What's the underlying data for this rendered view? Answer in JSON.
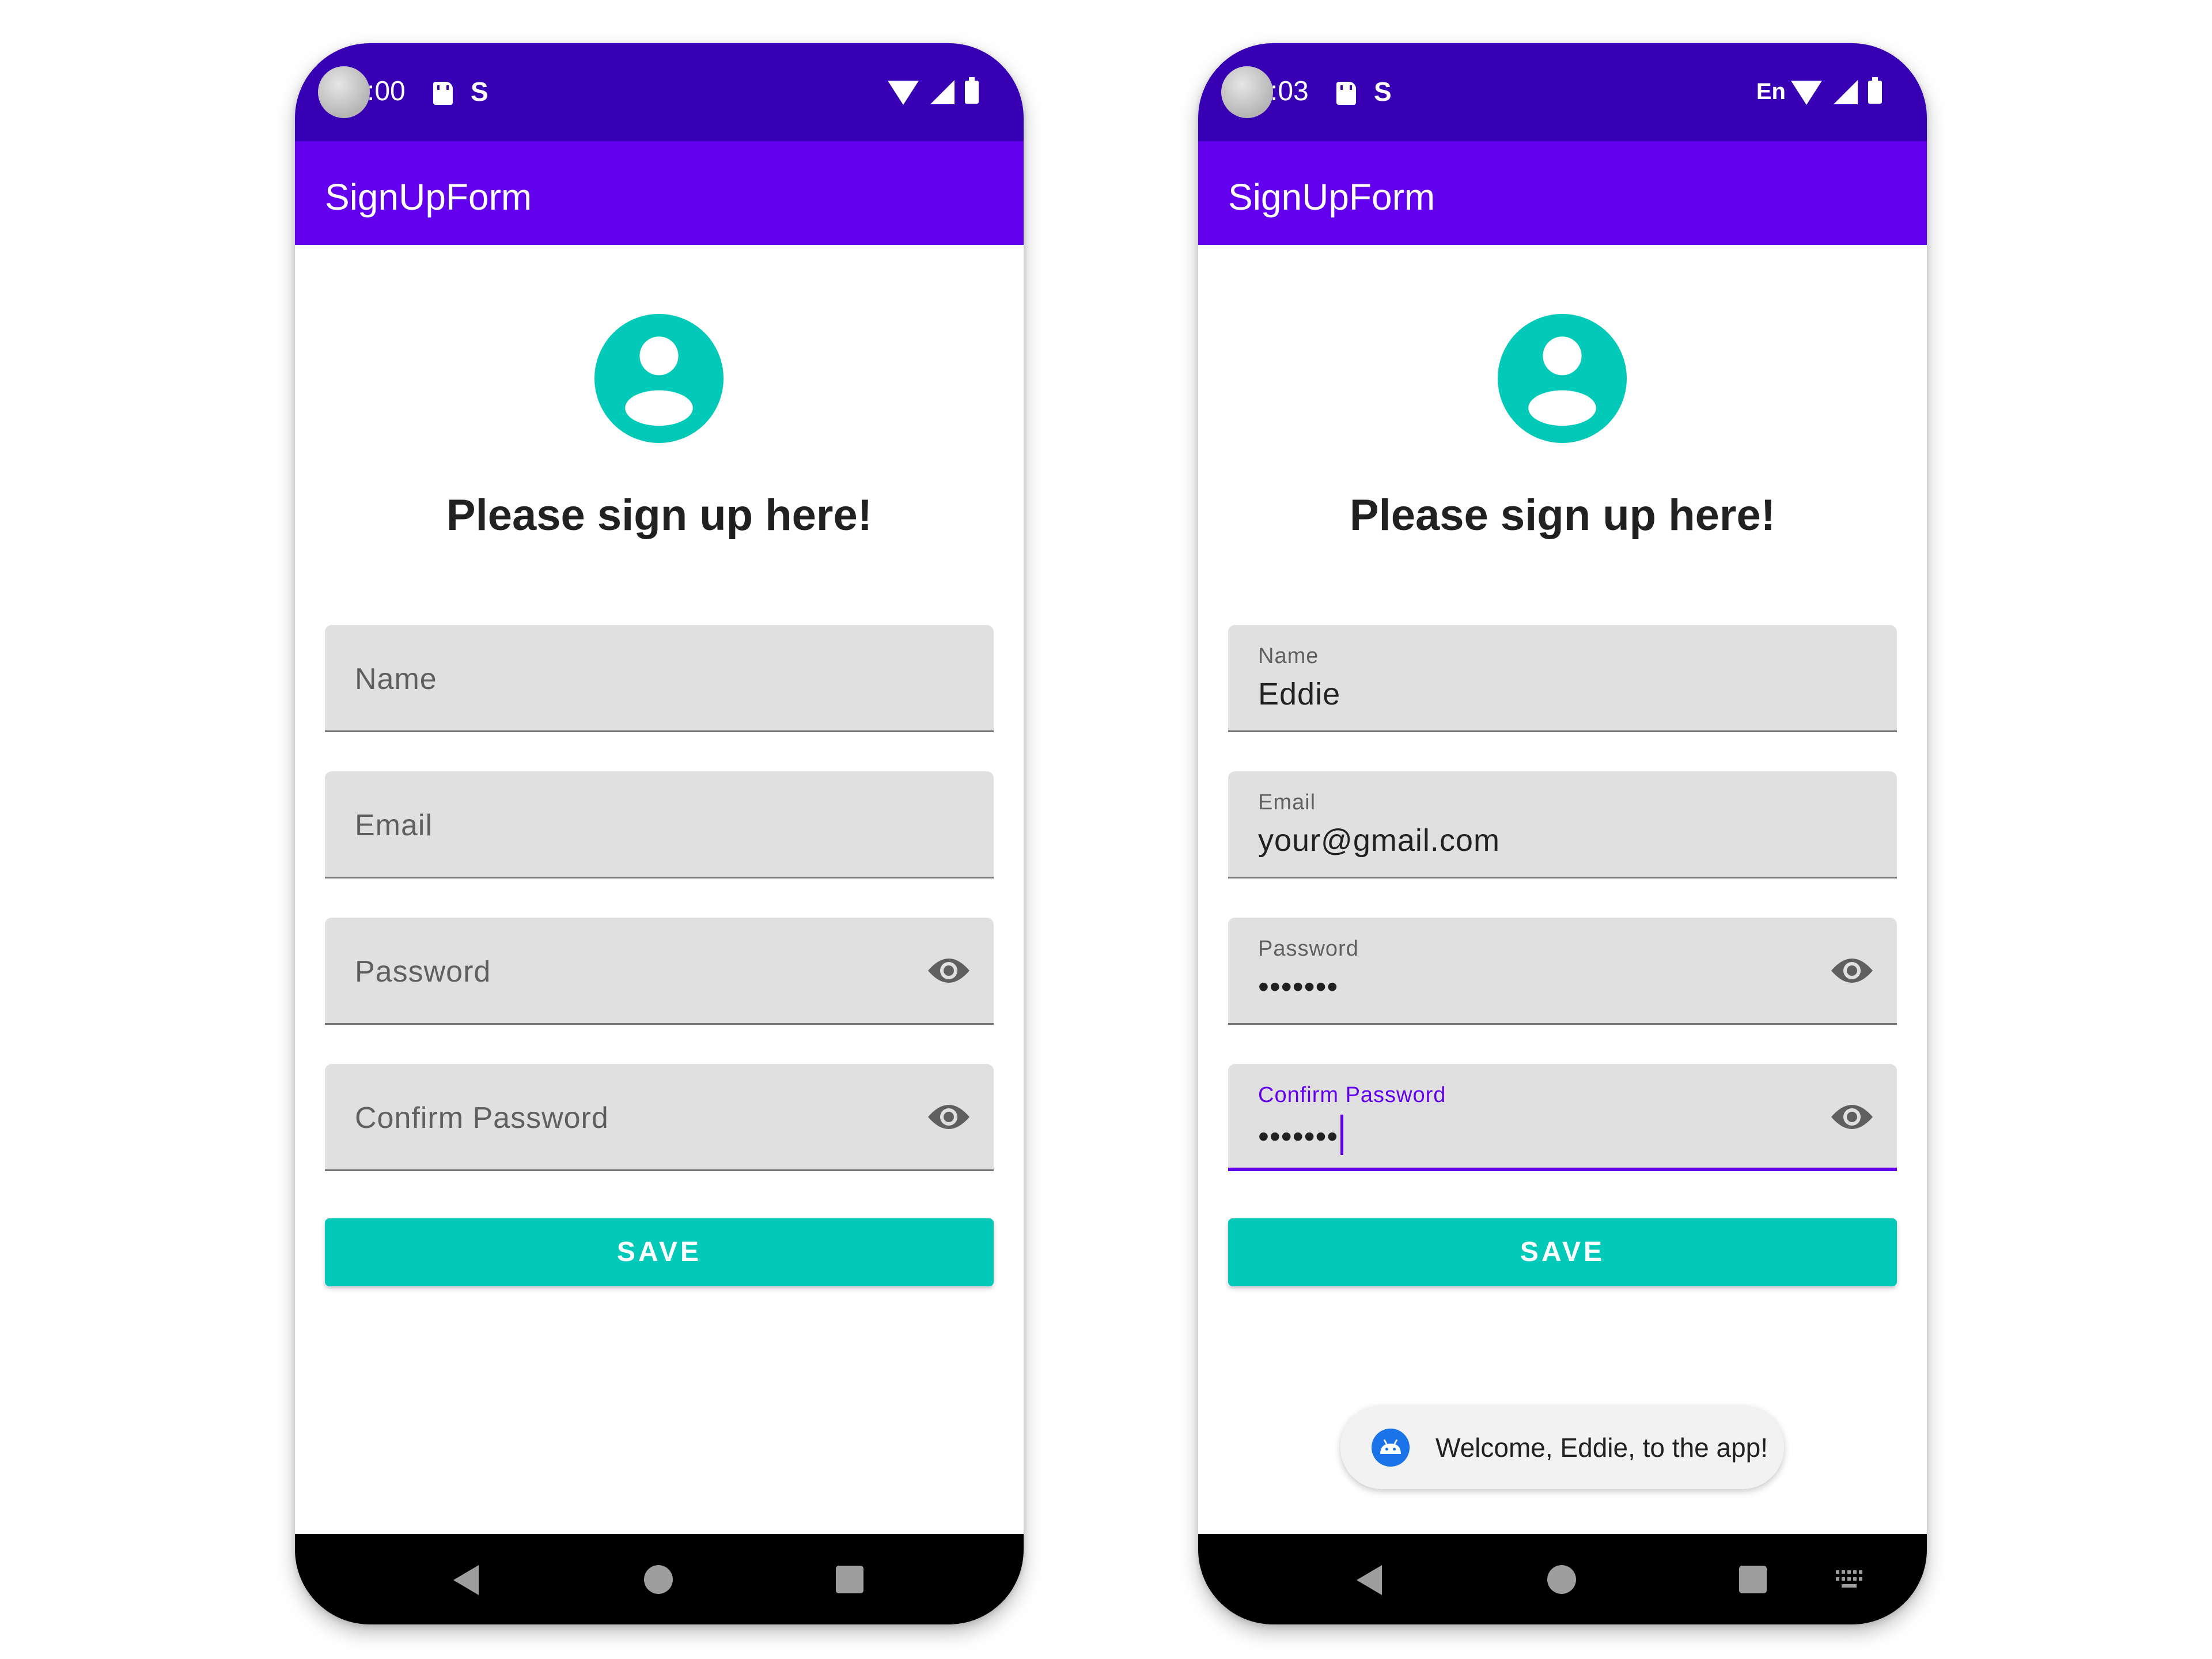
{
  "colors": {
    "status_bar": "#3700B3",
    "app_bar": "#6200EE",
    "accent": "#03C9B8",
    "focus": "#6200EE",
    "field_bg": "#e0e0e0",
    "toast_icon": "#1a73e8"
  },
  "screens": [
    {
      "status_bar": {
        "time": ":00",
        "icons": [
          "sd-card-icon",
          "s-notification-icon",
          "wifi-icon",
          "signal-icon",
          "battery-icon"
        ]
      },
      "app_bar": {
        "title": "SignUpForm"
      },
      "avatar_icon": "account-circle-icon",
      "heading": "Please sign up here!",
      "fields": [
        {
          "placeholder": "Name"
        },
        {
          "placeholder": "Email"
        },
        {
          "placeholder": "Password",
          "icon": "eye-icon"
        },
        {
          "placeholder": "Confirm Password",
          "icon": "eye-icon"
        }
      ],
      "save_button": {
        "label": "SAVE"
      },
      "nav_bar": {
        "buttons": [
          "back-icon",
          "home-icon",
          "recents-icon"
        ]
      }
    },
    {
      "status_bar": {
        "time": ":03",
        "language": "En",
        "icons": [
          "sd-card-icon",
          "s-notification-icon",
          "wifi-icon",
          "signal-icon",
          "battery-icon"
        ]
      },
      "app_bar": {
        "title": "SignUpForm"
      },
      "avatar_icon": "account-circle-icon",
      "heading": "Please sign up here!",
      "fields": [
        {
          "label": "Name",
          "value": "Eddie"
        },
        {
          "label": "Email",
          "value": "your@gmail.com"
        },
        {
          "label": "Password",
          "value": "•••••••",
          "icon": "eye-icon"
        },
        {
          "label": "Confirm Password",
          "value": "•••••••",
          "icon": "eye-icon",
          "focused": true
        }
      ],
      "save_button": {
        "label": "SAVE"
      },
      "toast": {
        "message": "Welcome, Eddie, to the app!",
        "icon": "android-icon"
      },
      "nav_bar": {
        "buttons": [
          "back-icon",
          "home-icon",
          "recents-icon",
          "keyboard-icon"
        ]
      }
    }
  ]
}
